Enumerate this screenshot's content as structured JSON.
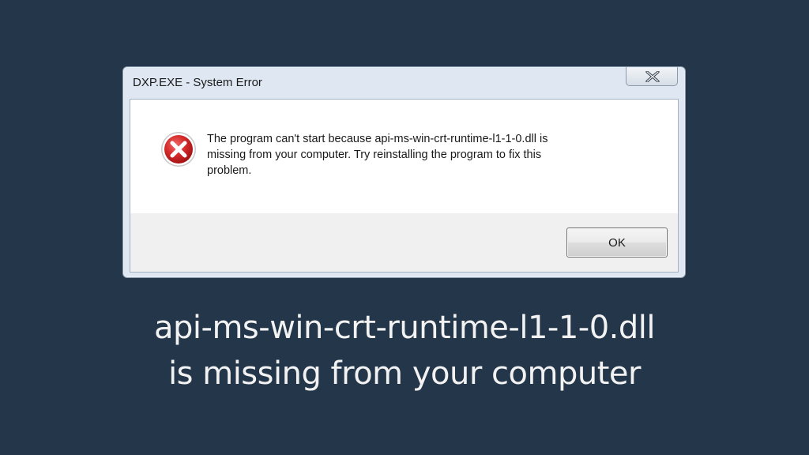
{
  "window": {
    "title": "DXP.EXE - System Error"
  },
  "dialog": {
    "icon": "error-icon",
    "message_lines": [
      "The program can't start because api-ms-win-crt-runtime-l1-1-0.dll is",
      "missing from your computer. Try reinstalling the program to fix this",
      "problem."
    ],
    "ok_label": "OK"
  },
  "caption": {
    "line1": "api-ms-win-crt-runtime-l1-1-0.dll",
    "line2": "is missing from your computer"
  },
  "colors": {
    "background": "#243649",
    "error_red": "#d42a2a"
  }
}
